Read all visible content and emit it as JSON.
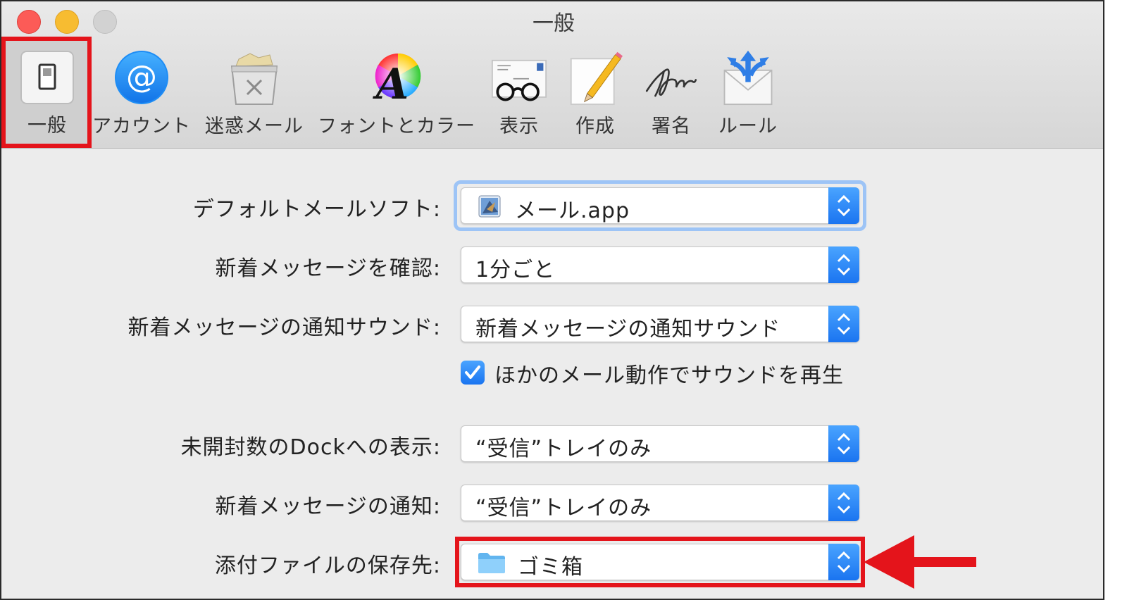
{
  "window": {
    "title": "一般"
  },
  "toolbar": {
    "items": [
      {
        "label": "一般",
        "icon": "general-switch-icon"
      },
      {
        "label": "アカウント",
        "icon": "at-sign-icon"
      },
      {
        "label": "迷惑メール",
        "icon": "junk-trash-icon"
      },
      {
        "label": "フォントとカラー",
        "icon": "font-color-icon"
      },
      {
        "label": "表示",
        "icon": "glasses-envelope-icon"
      },
      {
        "label": "作成",
        "icon": "pencil-paper-icon"
      },
      {
        "label": "署名",
        "icon": "signature-icon"
      },
      {
        "label": "ルール",
        "icon": "rules-envelope-icon"
      }
    ]
  },
  "settings": {
    "default_mail": {
      "label": "デフォルトメールソフト:",
      "value": "メール.app"
    },
    "check_new": {
      "label": "新着メッセージを確認:",
      "value": "1分ごと"
    },
    "sound": {
      "label": "新着メッセージの通知サウンド:",
      "value": "新着メッセージの通知サウンド"
    },
    "play_sounds": {
      "label": "ほかのメール動作でサウンドを再生",
      "checked": true
    },
    "dock_unread": {
      "label": "未開封数のDockへの表示:",
      "value": "“受信”トレイのみ"
    },
    "notifications": {
      "label": "新着メッセージの通知:",
      "value": "“受信”トレイのみ"
    },
    "downloads": {
      "label": "添付ファイルの保存先:",
      "value": "ゴミ箱"
    }
  },
  "colors": {
    "highlight": "#e4141b",
    "accent": "#1a74f0"
  }
}
